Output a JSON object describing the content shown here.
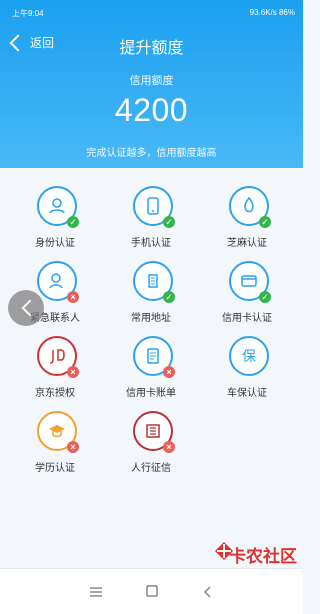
{
  "status_bar": {
    "time": "上午9:04",
    "right": "93.6K/s  86%"
  },
  "header": {
    "back_label": "返回",
    "title": "提升额度"
  },
  "credit": {
    "label": "信用额度",
    "value": "4200",
    "sub": "完成认证越多，信用额度越高"
  },
  "items": [
    {
      "label": "身份认证",
      "status": "ok"
    },
    {
      "label": "手机认证",
      "status": "ok"
    },
    {
      "label": "芝麻认证",
      "status": "ok"
    },
    {
      "label": "紧急联系人",
      "status": "error"
    },
    {
      "label": "常用地址",
      "status": "ok"
    },
    {
      "label": "信用卡认证",
      "status": "ok"
    },
    {
      "label": "京东授权",
      "status": "error"
    },
    {
      "label": "信用卡账单",
      "status": "error"
    },
    {
      "label": "车保认证",
      "status": "none"
    },
    {
      "label": "学历认证",
      "status": "error"
    },
    {
      "label": "人行征信",
      "status": "error"
    }
  ],
  "watermark_text": "卡农社区",
  "colors": {
    "accent": "#1aa0ef",
    "success": "#35b64b",
    "error": "#e8605a"
  }
}
